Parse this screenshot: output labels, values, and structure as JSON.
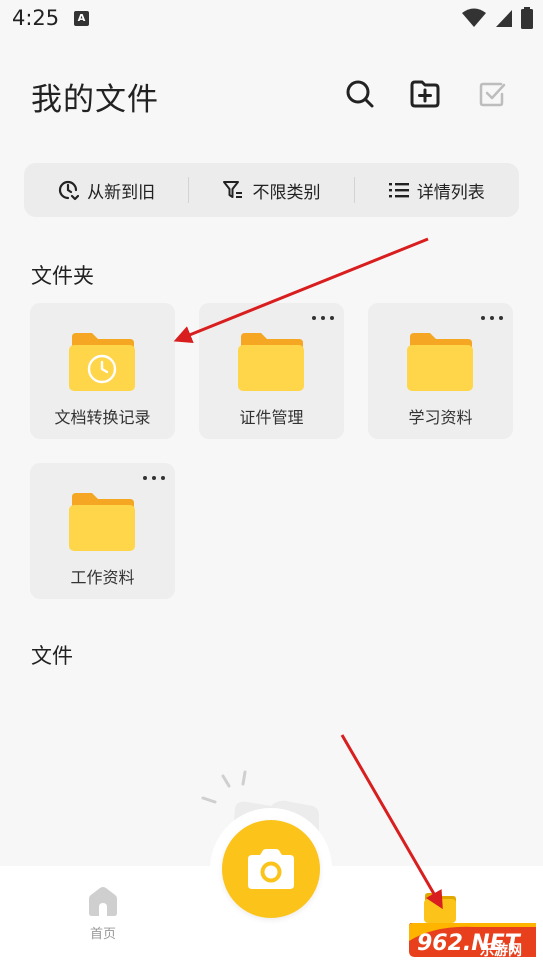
{
  "status_bar": {
    "time": "4:25",
    "notification_glyph": "A"
  },
  "header": {
    "title": "我的文件"
  },
  "toolbar": {
    "sort_label": "从新到旧",
    "filter_label": "不限类别",
    "view_label": "详情列表"
  },
  "sections": {
    "folders_title": "文件夹",
    "files_title": "文件"
  },
  "folders": [
    {
      "name": "文档转换记录",
      "has_more": false,
      "icon": "history-folder-icon"
    },
    {
      "name": "证件管理",
      "has_more": true,
      "icon": "folder-icon"
    },
    {
      "name": "学习资料",
      "has_more": true,
      "icon": "folder-icon"
    },
    {
      "name": "工作资料",
      "has_more": true,
      "icon": "folder-icon"
    }
  ],
  "bottom_nav": {
    "home_label": "首页"
  },
  "watermark": {
    "brand": "962.NET",
    "tagline": "乐游网"
  },
  "colors": {
    "accent": "#fcc31a",
    "folder_back": "#f5a623",
    "folder_front": "#ffd54a",
    "arrow": "#d81e1e"
  }
}
